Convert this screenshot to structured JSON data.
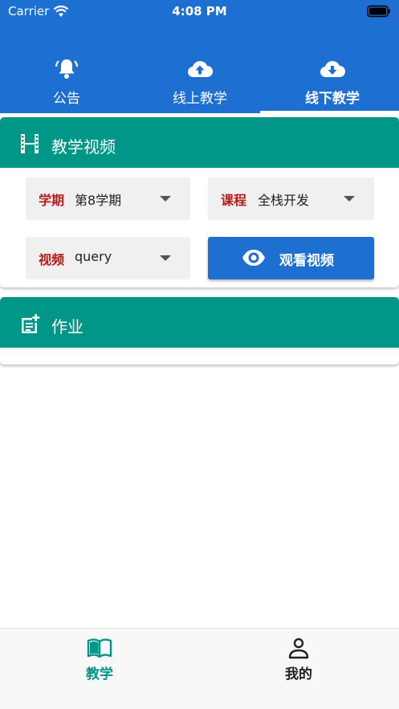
{
  "status_bar": {
    "carrier": "Carrier",
    "time": "4:08 PM"
  },
  "tabs": [
    {
      "label": "公告",
      "icon": "bell-ring-icon",
      "active": false
    },
    {
      "label": "线上教学",
      "icon": "cloud-upload-icon",
      "active": false
    },
    {
      "label": "线下教学",
      "icon": "cloud-download-icon",
      "active": true
    }
  ],
  "video_section": {
    "title": "教学视频",
    "icon": "film-icon",
    "semester": {
      "label": "学期",
      "value": "第8学期"
    },
    "course": {
      "label": "课程",
      "value": "全栈开发"
    },
    "video": {
      "label": "视频",
      "value": "query"
    },
    "watch_button": {
      "label": "观看视频",
      "icon": "eye-icon"
    }
  },
  "homework_section": {
    "title": "作业",
    "icon": "note-add-icon"
  },
  "bottom_nav": [
    {
      "label": "教学",
      "icon": "book-open-icon",
      "active": true
    },
    {
      "label": "我的",
      "icon": "person-icon",
      "active": false
    }
  ],
  "colors": {
    "primary": "#1e6fd2",
    "header_teal": "#009688",
    "label_red": "#b71c1c",
    "nav_active": "#009688",
    "nav_inactive": "#212121"
  }
}
